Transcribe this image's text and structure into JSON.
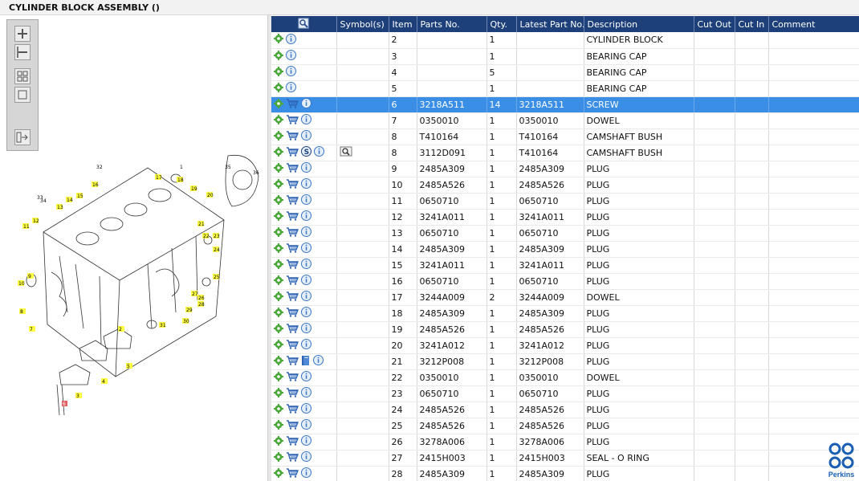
{
  "app": {
    "title": "CYLINDER BLOCK ASSEMBLY ()",
    "brand": "Perkins"
  },
  "colors": {
    "header_bg": "#1d3f7a",
    "selected_row": "#3b8ee6",
    "callout_yellow": "#ffff44",
    "gear_green": "#4aa83a",
    "info_blue": "#3a76c4",
    "brand_blue": "#1a5fb4"
  },
  "zoom_toolbar": {
    "buttons": [
      {
        "name": "zoom-in-icon"
      },
      {
        "name": "zoom-out-icon"
      },
      {
        "name": "fit-all-icon"
      },
      {
        "name": "fit-window-icon"
      },
      {
        "name": "export-icon"
      }
    ]
  },
  "drawing": {
    "callouts": [
      "1",
      "2",
      "3",
      "4",
      "5",
      "6",
      "7",
      "8",
      "9",
      "10",
      "11",
      "12",
      "13",
      "14",
      "15",
      "16",
      "17",
      "18",
      "19",
      "20",
      "21",
      "22",
      "23",
      "24",
      "25",
      "26",
      "27",
      "28",
      "29",
      "30",
      "31",
      "32",
      "33",
      "34",
      "35",
      "36"
    ]
  },
  "table": {
    "columns": [
      "",
      "Symbol(s)",
      "Item",
      "Parts No.",
      "Qty.",
      "Latest Part No.",
      "Description",
      "Cut Out",
      "Cut In",
      "Comment"
    ],
    "rows": [
      {
        "icons": [
          "gear-icon",
          "info-icon"
        ],
        "symbols": [],
        "item": "2",
        "part": "",
        "qty": "1",
        "latest": "",
        "desc": "CYLINDER BLOCK",
        "selected": false
      },
      {
        "icons": [
          "gear-icon",
          "info-icon"
        ],
        "symbols": [],
        "item": "3",
        "part": "",
        "qty": "1",
        "latest": "",
        "desc": "BEARING CAP",
        "selected": false
      },
      {
        "icons": [
          "gear-icon",
          "info-icon"
        ],
        "symbols": [],
        "item": "4",
        "part": "",
        "qty": "5",
        "latest": "",
        "desc": "BEARING CAP",
        "selected": false
      },
      {
        "icons": [
          "gear-icon",
          "info-icon"
        ],
        "symbols": [],
        "item": "5",
        "part": "",
        "qty": "1",
        "latest": "",
        "desc": "BEARING CAP",
        "selected": false
      },
      {
        "icons": [
          "gear-icon",
          "cart-icon",
          "info-icon"
        ],
        "symbols": [],
        "item": "6",
        "part": "3218A511",
        "qty": "14",
        "latest": "3218A511",
        "desc": "SCREW",
        "selected": true
      },
      {
        "icons": [
          "gear-icon",
          "cart-icon",
          "info-icon"
        ],
        "symbols": [],
        "item": "7",
        "part": "0350010",
        "qty": "1",
        "latest": "0350010",
        "desc": "DOWEL",
        "selected": false
      },
      {
        "icons": [
          "gear-icon",
          "cart-icon",
          "info-icon"
        ],
        "symbols": [],
        "item": "8",
        "part": "T410164",
        "qty": "1",
        "latest": "T410164",
        "desc": "CAMSHAFT BUSH",
        "selected": false
      },
      {
        "icons": [
          "gear-icon",
          "cart-icon",
          "service-icon",
          "info-icon"
        ],
        "symbols": [
          "view-drawing-icon"
        ],
        "item": "8",
        "part": "3112D091",
        "qty": "1",
        "latest": "T410164",
        "desc": "CAMSHAFT BUSH",
        "selected": false
      },
      {
        "icons": [
          "gear-icon",
          "cart-icon",
          "info-icon"
        ],
        "symbols": [],
        "item": "9",
        "part": "2485A309",
        "qty": "1",
        "latest": "2485A309",
        "desc": "PLUG",
        "selected": false
      },
      {
        "icons": [
          "gear-icon",
          "cart-icon",
          "info-icon"
        ],
        "symbols": [],
        "item": "10",
        "part": "2485A526",
        "qty": "1",
        "latest": "2485A526",
        "desc": "PLUG",
        "selected": false
      },
      {
        "icons": [
          "gear-icon",
          "cart-icon",
          "info-icon"
        ],
        "symbols": [],
        "item": "11",
        "part": "0650710",
        "qty": "1",
        "latest": "0650710",
        "desc": "PLUG",
        "selected": false
      },
      {
        "icons": [
          "gear-icon",
          "cart-icon",
          "info-icon"
        ],
        "symbols": [],
        "item": "12",
        "part": "3241A011",
        "qty": "1",
        "latest": "3241A011",
        "desc": "PLUG",
        "selected": false
      },
      {
        "icons": [
          "gear-icon",
          "cart-icon",
          "info-icon"
        ],
        "symbols": [],
        "item": "13",
        "part": "0650710",
        "qty": "1",
        "latest": "0650710",
        "desc": "PLUG",
        "selected": false
      },
      {
        "icons": [
          "gear-icon",
          "cart-icon",
          "info-icon"
        ],
        "symbols": [],
        "item": "14",
        "part": "2485A309",
        "qty": "1",
        "latest": "2485A309",
        "desc": "PLUG",
        "selected": false
      },
      {
        "icons": [
          "gear-icon",
          "cart-icon",
          "info-icon"
        ],
        "symbols": [],
        "item": "15",
        "part": "3241A011",
        "qty": "1",
        "latest": "3241A011",
        "desc": "PLUG",
        "selected": false
      },
      {
        "icons": [
          "gear-icon",
          "cart-icon",
          "info-icon"
        ],
        "symbols": [],
        "item": "16",
        "part": "0650710",
        "qty": "1",
        "latest": "0650710",
        "desc": "PLUG",
        "selected": false
      },
      {
        "icons": [
          "gear-icon",
          "cart-icon",
          "info-icon"
        ],
        "symbols": [],
        "item": "17",
        "part": "3244A009",
        "qty": "2",
        "latest": "3244A009",
        "desc": "DOWEL",
        "selected": false
      },
      {
        "icons": [
          "gear-icon",
          "cart-icon",
          "info-icon"
        ],
        "symbols": [],
        "item": "18",
        "part": "2485A309",
        "qty": "1",
        "latest": "2485A309",
        "desc": "PLUG",
        "selected": false
      },
      {
        "icons": [
          "gear-icon",
          "cart-icon",
          "info-icon"
        ],
        "symbols": [],
        "item": "19",
        "part": "2485A526",
        "qty": "1",
        "latest": "2485A526",
        "desc": "PLUG",
        "selected": false
      },
      {
        "icons": [
          "gear-icon",
          "cart-icon",
          "info-icon"
        ],
        "symbols": [],
        "item": "20",
        "part": "3241A012",
        "qty": "1",
        "latest": "3241A012",
        "desc": "PLUG",
        "selected": false
      },
      {
        "icons": [
          "gear-icon",
          "cart-icon",
          "book-icon",
          "info-icon"
        ],
        "symbols": [],
        "item": "21",
        "part": "3212P008",
        "qty": "1",
        "latest": "3212P008",
        "desc": "PLUG",
        "selected": false
      },
      {
        "icons": [
          "gear-icon",
          "cart-icon",
          "info-icon"
        ],
        "symbols": [],
        "item": "22",
        "part": "0350010",
        "qty": "1",
        "latest": "0350010",
        "desc": "DOWEL",
        "selected": false
      },
      {
        "icons": [
          "gear-icon",
          "cart-icon",
          "info-icon"
        ],
        "symbols": [],
        "item": "23",
        "part": "0650710",
        "qty": "1",
        "latest": "0650710",
        "desc": "PLUG",
        "selected": false
      },
      {
        "icons": [
          "gear-icon",
          "cart-icon",
          "info-icon"
        ],
        "symbols": [],
        "item": "24",
        "part": "2485A526",
        "qty": "1",
        "latest": "2485A526",
        "desc": "PLUG",
        "selected": false
      },
      {
        "icons": [
          "gear-icon",
          "cart-icon",
          "info-icon"
        ],
        "symbols": [],
        "item": "25",
        "part": "2485A526",
        "qty": "1",
        "latest": "2485A526",
        "desc": "PLUG",
        "selected": false
      },
      {
        "icons": [
          "gear-icon",
          "cart-icon",
          "info-icon"
        ],
        "symbols": [],
        "item": "26",
        "part": "3278A006",
        "qty": "1",
        "latest": "3278A006",
        "desc": "PLUG",
        "selected": false
      },
      {
        "icons": [
          "gear-icon",
          "cart-icon",
          "info-icon"
        ],
        "symbols": [],
        "item": "27",
        "part": "2415H003",
        "qty": "1",
        "latest": "2415H003",
        "desc": "SEAL - O RING",
        "selected": false
      },
      {
        "icons": [
          "gear-icon",
          "cart-icon",
          "info-icon"
        ],
        "symbols": [],
        "item": "28",
        "part": "2485A309",
        "qty": "1",
        "latest": "2485A309",
        "desc": "PLUG",
        "selected": false
      }
    ]
  }
}
